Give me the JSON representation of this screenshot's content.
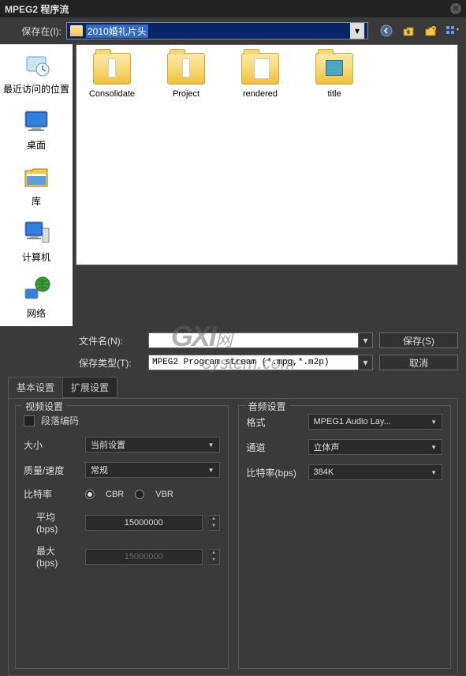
{
  "title": "MPEG2 程序流",
  "save_in_label": "保存在(I):",
  "path_text": "2010婚礼片头",
  "sidebar": [
    {
      "label": "最近访问的位置",
      "icon": "recent"
    },
    {
      "label": "桌面",
      "icon": "desktop"
    },
    {
      "label": "库",
      "icon": "library"
    },
    {
      "label": "计算机",
      "icon": "computer"
    },
    {
      "label": "网络",
      "icon": "network"
    }
  ],
  "folders": [
    {
      "label": "Consolidate"
    },
    {
      "label": "Project"
    },
    {
      "label": "rendered"
    },
    {
      "label": "title"
    }
  ],
  "filename_label": "文件名(N):",
  "filename_value": "",
  "filetype_label": "保存类型(T):",
  "filetype_value": "MPEG2 Program stream (*.mpg,*.m2p)",
  "save_btn": "保存(S)",
  "cancel_btn": "取消",
  "tabs": {
    "basic": "基本设置",
    "advanced": "扩展设置"
  },
  "video": {
    "legend": "视频设置",
    "segment": "段落编码",
    "size_label": "大小",
    "size_value": "当前设置",
    "quality_label": "质量/速度",
    "quality_value": "常规",
    "bitrate_label": "比特率",
    "cbr": "CBR",
    "vbr": "VBR",
    "avg_label": "平均 (bps)",
    "avg_value": "15000000",
    "max_label": "最大 (bps)",
    "max_value": "15000000"
  },
  "audio": {
    "legend": "音频设置",
    "format_label": "格式",
    "format_value": "MPEG1 Audio Lay...",
    "channel_label": "通道",
    "channel_value": "立体声",
    "bitrate_label": "比特率(bps)",
    "bitrate_value": "384K"
  },
  "watermark": {
    "logo": "GXI",
    "text": "system.com",
    "sub": "网"
  }
}
